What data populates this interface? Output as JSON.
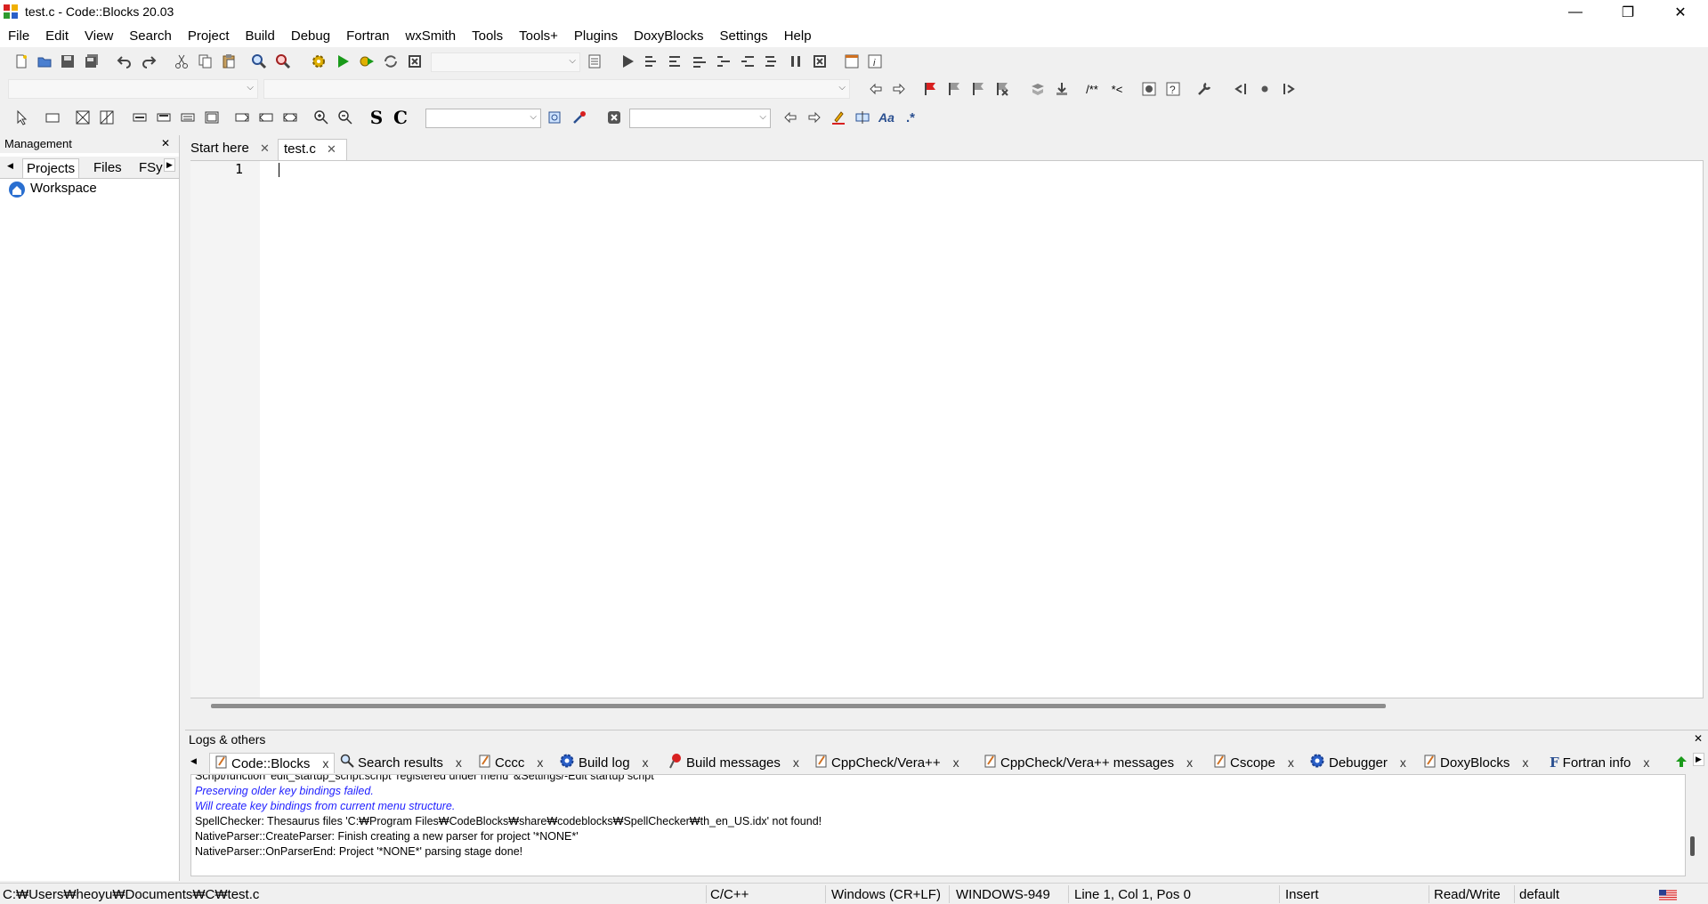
{
  "window": {
    "title": "test.c - Code::Blocks 20.03",
    "minimize": "—",
    "maximize": "❐",
    "close": "✕"
  },
  "menu": [
    "File",
    "Edit",
    "View",
    "Search",
    "Project",
    "Build",
    "Debug",
    "Fortran",
    "wxSmith",
    "Tools",
    "Tools+",
    "Plugins",
    "DoxyBlocks",
    "Settings",
    "Help"
  ],
  "toolbar3": {
    "text_s": "S",
    "text_c": "C",
    "regex": ".*",
    "match_case": "Aa"
  },
  "management": {
    "title": "Management",
    "close": "✕",
    "tabs": [
      "Projects",
      "Files",
      "FSy"
    ],
    "tree": {
      "workspace": "Workspace"
    }
  },
  "editor": {
    "tabs": [
      {
        "label": "Start here",
        "close": "✕"
      },
      {
        "label": "test.c",
        "close": "✕"
      }
    ],
    "line_numbers": [
      "1"
    ]
  },
  "logs": {
    "title": "Logs & others",
    "close": "✕",
    "tabs": [
      {
        "label": "Code::Blocks",
        "icon": "notepad-icon"
      },
      {
        "label": "Search results",
        "icon": "magnifier-icon"
      },
      {
        "label": "Cccc",
        "icon": "notepad-icon"
      },
      {
        "label": "Build log",
        "icon": "gear-icon"
      },
      {
        "label": "Build messages",
        "icon": "pin-icon"
      },
      {
        "label": "CppCheck/Vera++",
        "icon": "notepad-icon"
      },
      {
        "label": "CppCheck/Vera++ messages",
        "icon": "notepad-icon"
      },
      {
        "label": "Cscope",
        "icon": "notepad-icon"
      },
      {
        "label": "Debugger",
        "icon": "gear-icon"
      },
      {
        "label": "DoxyBlocks",
        "icon": "notepad-icon"
      },
      {
        "label": "Fortran info",
        "icon": "fortran-icon"
      }
    ],
    "tab_close": "x",
    "lines": [
      {
        "text": "Script/function 'edit_startup_script.script' registered under menu '&Settings/-Edit startup script'",
        "style": "normal"
      },
      {
        "text": "Preserving older key bindings failed.",
        "style": "blue"
      },
      {
        "text": "Will create key bindings from current menu structure.",
        "style": "blue"
      },
      {
        "text": "SpellChecker: Thesaurus files 'C:₩Program Files₩CodeBlocks₩share₩codeblocks₩SpellChecker₩th_en_US.idx' not found!",
        "style": "normal"
      },
      {
        "text": "NativeParser::CreateParser: Finish creating a new parser for project '*NONE*'",
        "style": "normal"
      },
      {
        "text": "NativeParser::OnParserEnd: Project '*NONE*' parsing stage done!",
        "style": "normal"
      }
    ]
  },
  "status": {
    "path": "C:₩Users₩heoyu₩Documents₩C₩test.c",
    "language": "C/C++",
    "eol": "Windows (CR+LF)",
    "encoding": "WINDOWS-949",
    "position": "Line 1, Col 1, Pos 0",
    "mode": "Insert",
    "access": "Read/Write",
    "profile": "default"
  },
  "colors": {
    "accent_blue": "#1f1fff",
    "flag_red": "#d82020",
    "run_green": "#1a9a1a"
  }
}
